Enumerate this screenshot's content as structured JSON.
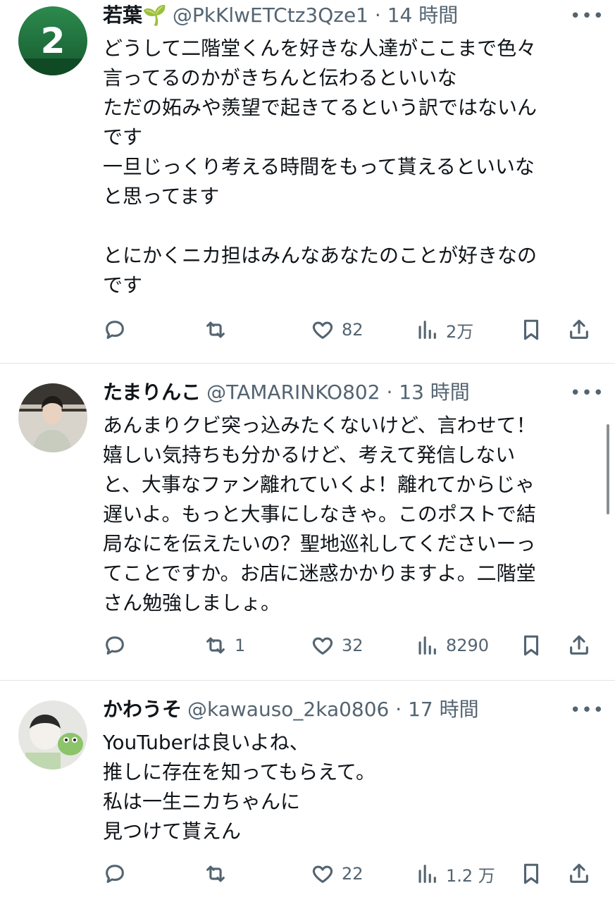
{
  "posts": [
    {
      "name": "若葉🌱",
      "handle": "@PkKlwETCtz3Qze1",
      "time": "14 時間",
      "avatar_label": "2",
      "text": "どうして二階堂くんを好きな人達がここまで色々\n言ってるのかがきちんと伝わるといいな\nただの妬みや羨望で起きてるという訳ではないん\nです\n一旦じっくり考える時間をもって貰えるといいな\nと思ってます\n\nとにかくニカ担はみんなあなたのことが好きなの\nです",
      "reply_count": "",
      "repost_count": "",
      "like_count": "82",
      "view_count": "2万"
    },
    {
      "name": "たまりんこ",
      "handle": "@TAMARINKO802",
      "time": "13 時間",
      "text": "あんまりクビ突っ込みたくないけど、言わせて！\n嬉しい気持ちも分かるけど、考えて発信しない\nと、大事なファン離れていくよ！離れてからじゃ\n遅いよ。もっと大事にしなきゃ。このポストで結\n局なにを伝えたいの？聖地巡礼してくださいーっ\nてことですか。お店に迷惑かかりますよ。二階堂\nさん勉強しましょ。",
      "reply_count": "",
      "repost_count": "1",
      "like_count": "32",
      "view_count": "8290"
    },
    {
      "name": "かわうそ",
      "handle": "@kawauso_2ka0806",
      "time": "17 時間",
      "text": "YouTuberは良いよね、\n推しに存在を知ってもらえて。\n私は一生ニカちゃんに\n見つけて貰えん",
      "reply_count": "",
      "repost_count": "",
      "like_count": "22",
      "view_count": "1.2 万"
    }
  ],
  "separator": "·",
  "icons": {
    "reply": "speech-bubble-icon",
    "repost": "repost-arrows-icon",
    "like": "heart-icon",
    "views": "bar-chart-icon",
    "bookmark": "bookmark-icon",
    "share": "share-upload-icon",
    "more": "more-dots-icon"
  },
  "colors": {
    "text": "#0f1419",
    "muted": "#536471",
    "divider": "#e1e5e8",
    "avatar1_bg": "#1f6b3a"
  }
}
